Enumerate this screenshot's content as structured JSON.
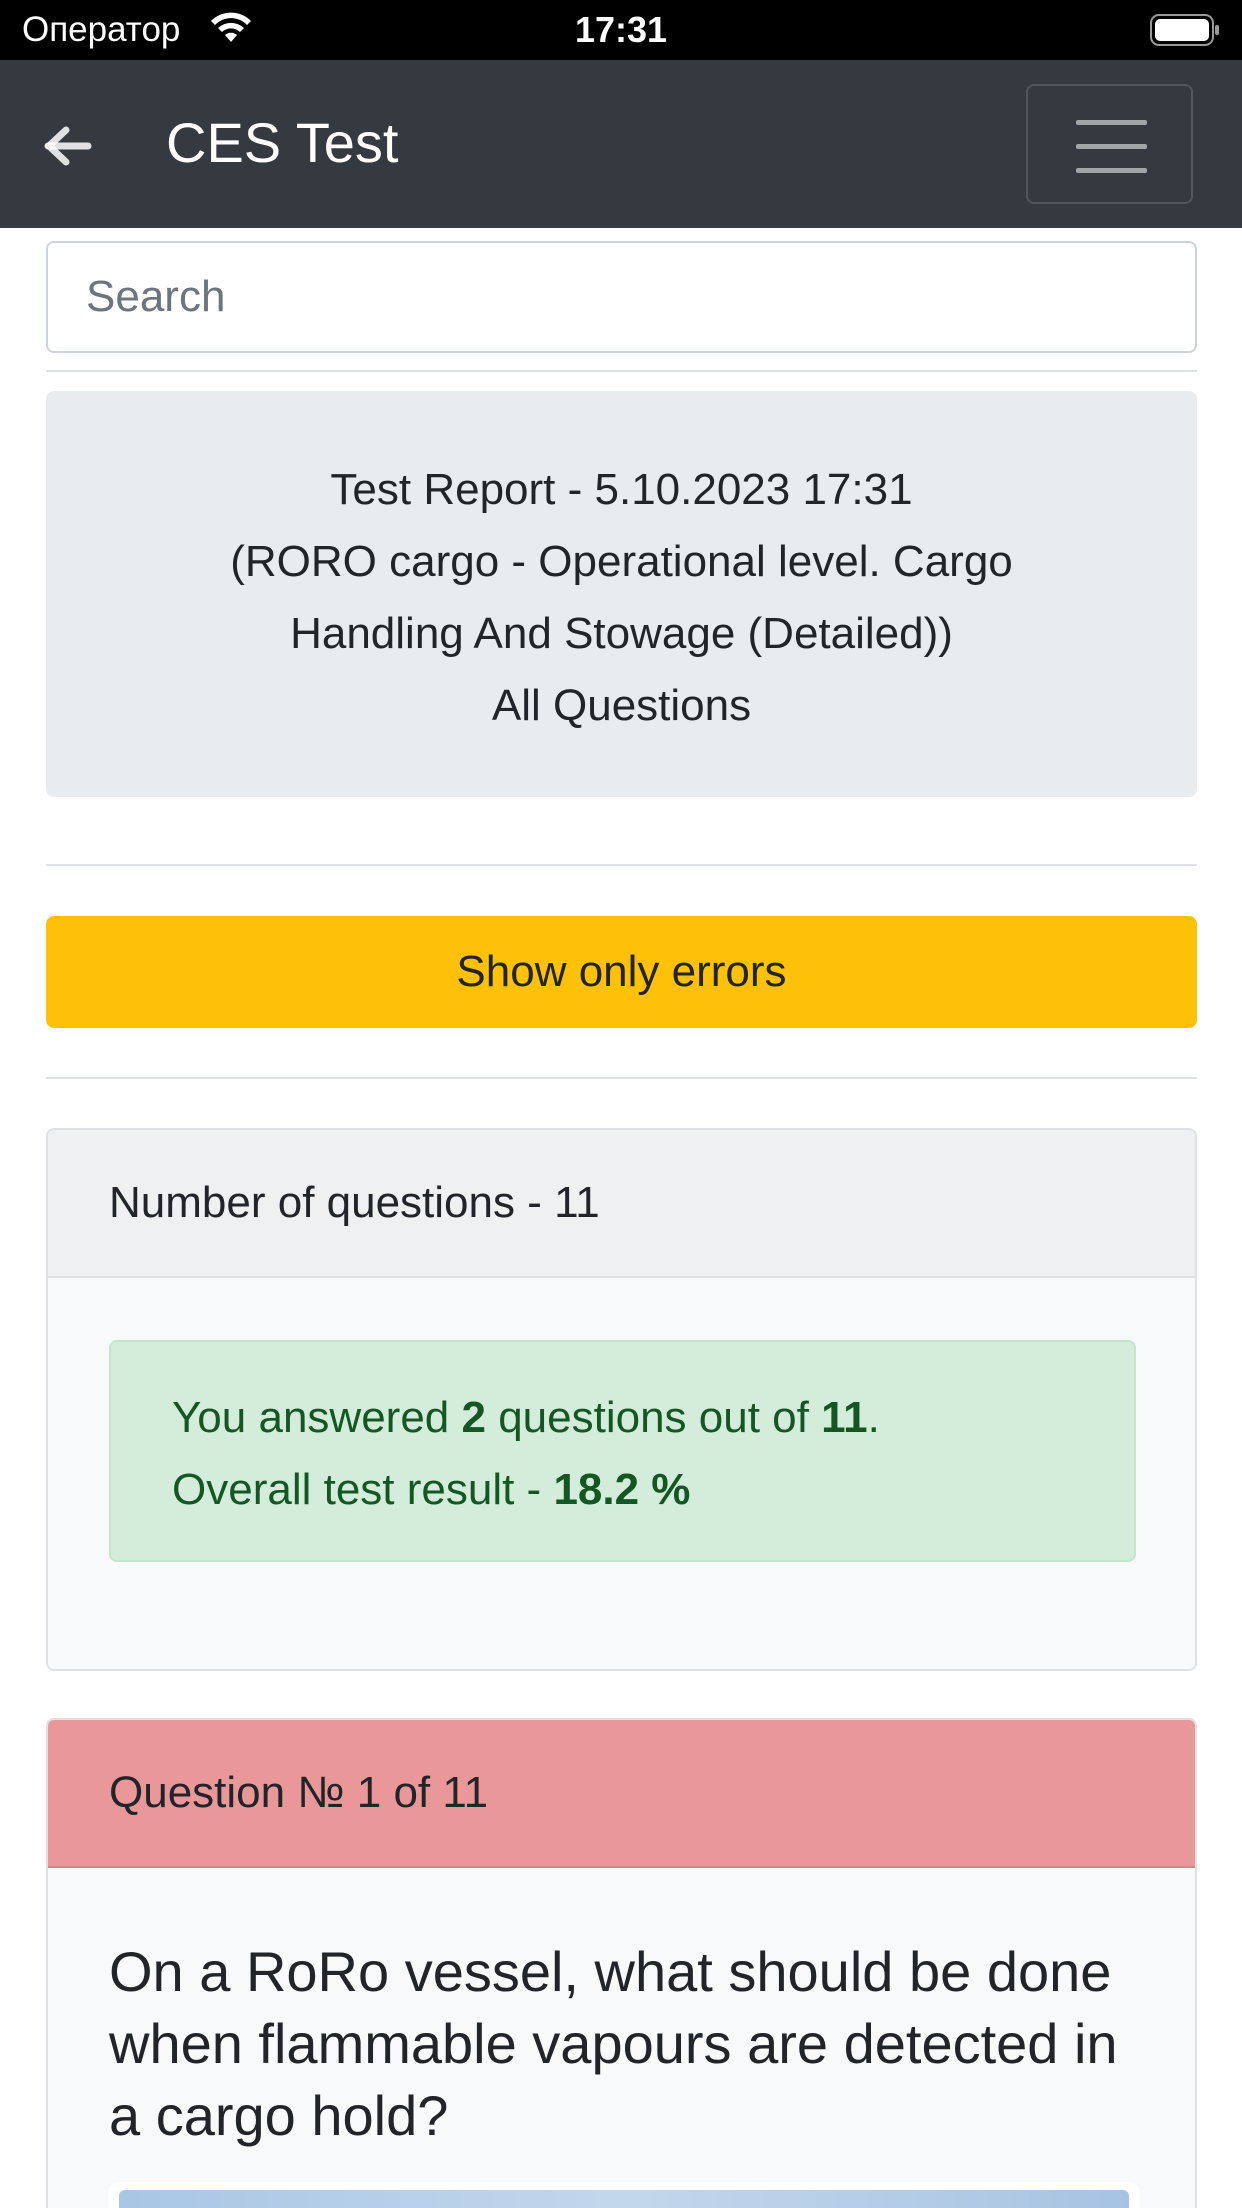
{
  "status_bar": {
    "carrier": "Оператор",
    "time": "17:31"
  },
  "navbar": {
    "title": "CES Test",
    "back_icon": "arrow-left-icon",
    "menu_icon": "hamburger-menu-icon"
  },
  "search": {
    "placeholder": "Search",
    "value": ""
  },
  "report": {
    "lines": [
      "Test Report - 5.10.2023 17:31",
      "(RORO cargo - Operational level. Cargo",
      "Handling And Stowage (Detailed))",
      "All Questions"
    ]
  },
  "errors_button": {
    "label": "Show only errors"
  },
  "summary": {
    "header": "Number of questions - 11",
    "answered_prefix": "You answered ",
    "answered_count": "2",
    "answered_middle": " questions out of ",
    "total_count": "11",
    "answered_suffix": ".",
    "result_prefix": "Overall test result - ",
    "result_value": "18.2 %"
  },
  "question": {
    "header": "Question № 1 of 11",
    "text": "On a RoRo vessel, what should be done when flammable vapours are detected in a cargo hold?"
  },
  "colors": {
    "navbar": "#343a40",
    "warning": "#ffc107",
    "success_bg": "#d4edda",
    "success_text": "#155724",
    "danger_header": "#ea9799"
  }
}
